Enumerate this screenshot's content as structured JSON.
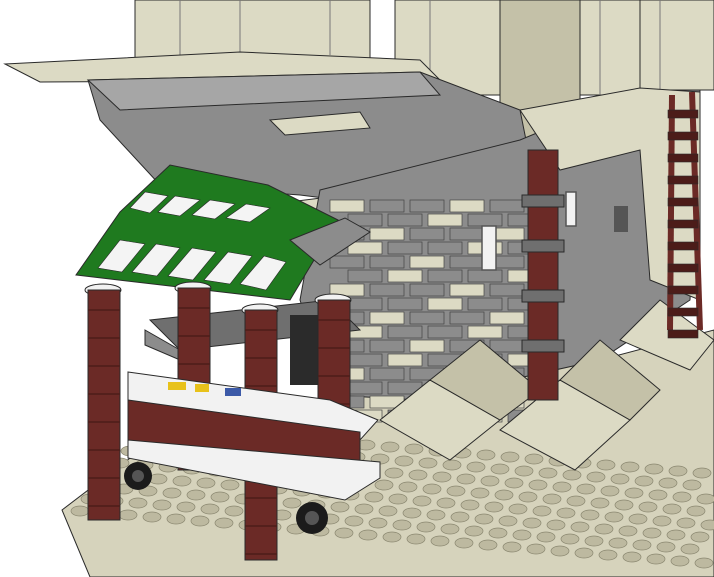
{
  "scene": {
    "kind": "lego-style 3D render of a market stall in front of a stone building",
    "colors": {
      "background": "#ffffff",
      "baseplate": "#d6d3bc",
      "baseplate_shadow": "#bdb9a0",
      "tan_stone": "#dcdac4",
      "tan_dark": "#c4c1a8",
      "gray_stone": "#8c8c8c",
      "gray_dark": "#6f6f6f",
      "gray_light": "#a6a6a6",
      "awning_green": "#1f7a1f",
      "awning_white": "#f4f4f4",
      "pillar_red": "#6b2a26",
      "pillar_dark": "#4c1c19",
      "counter_white": "#f2f2f2",
      "wheel_black": "#1b1b1b",
      "crate_yellow": "#e8c21b",
      "crate_blue": "#3c5aa8",
      "outline": "#2a2a2a"
    }
  }
}
